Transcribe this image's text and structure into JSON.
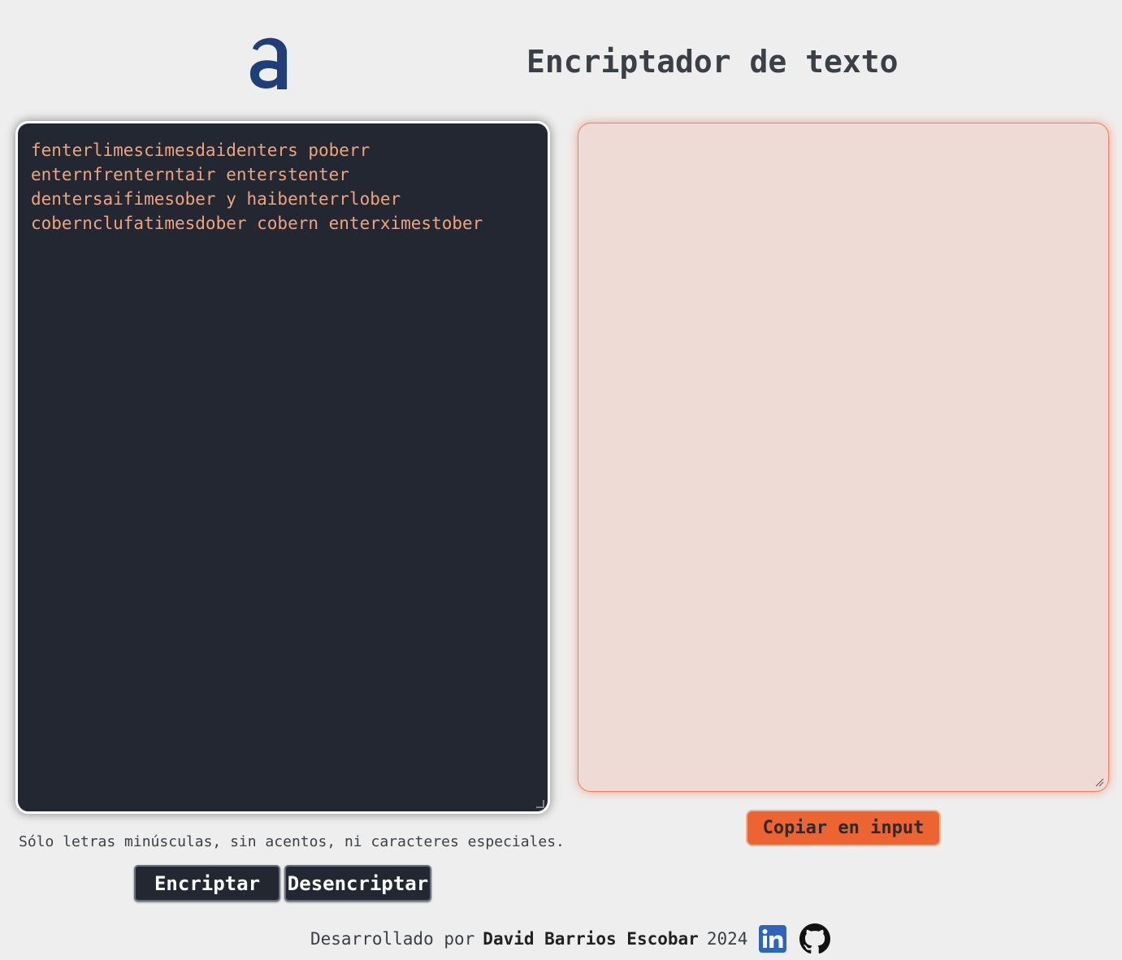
{
  "header": {
    "logo_icon": "alura-a-logo-icon",
    "title": "Encriptador de texto"
  },
  "input": {
    "value": "fenterlimescimesdaidenters poberr enternfrenterntair enterstenter dentersaifimesober y haibenterrlober cobernclufatimesdober cobern enterximestober",
    "text_color": "#f3a37a",
    "background": "#222731"
  },
  "output": {
    "value": "",
    "background": "#eedbd6",
    "border_color": "#f07f5a"
  },
  "hint": "Sólo letras minúsculas, sin acentos, ni caracteres especiales.",
  "buttons": {
    "encrypt": "Encriptar",
    "decrypt": "Desencriptar",
    "copy": "Copiar en input",
    "copy_color": "#ec6432"
  },
  "footer": {
    "prefix": "Desarrollado por",
    "author": "David Barrios Escobar",
    "year": "2024",
    "icons": [
      "linkedin-icon",
      "github-icon"
    ]
  }
}
